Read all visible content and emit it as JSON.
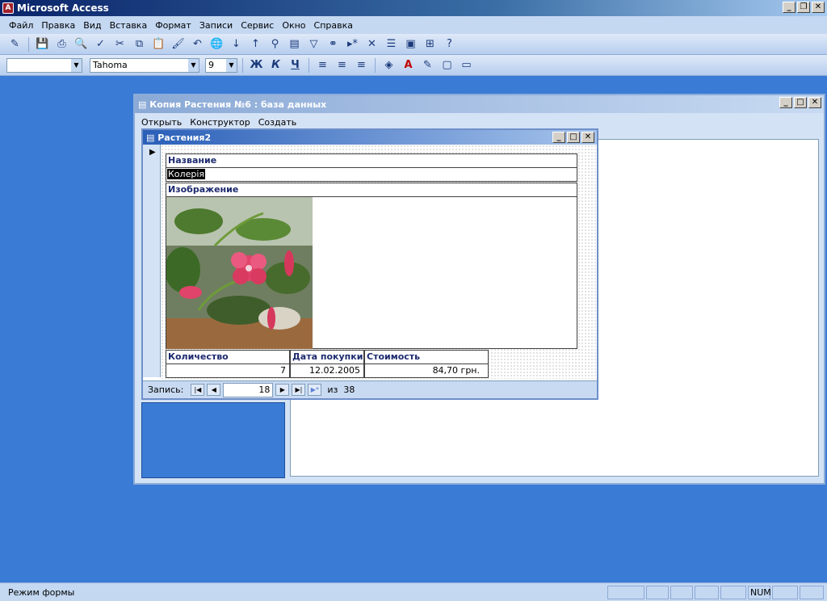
{
  "app": {
    "title": "Microsoft Access"
  },
  "menu": [
    "Файл",
    "Правка",
    "Вид",
    "Вставка",
    "Формат",
    "Записи",
    "Сервис",
    "Окно",
    "Справка"
  ],
  "format_toolbar": {
    "font": "Tahoma",
    "size": "9",
    "bold": "Ж",
    "italic": "К",
    "underline": "Ч"
  },
  "db_window": {
    "title": "Копия Растения №6 : база данных",
    "open": "Открыть",
    "design": "Конструктор",
    "create": "Создать"
  },
  "form": {
    "title": "Растения2",
    "name_label": "Название",
    "name_value": "Колерія",
    "image_label": "Изображение",
    "qty_label": "Количество",
    "qty_value": "7",
    "date_label": "Дата покупки",
    "date_value": "12.02.2005",
    "cost_label": "Стоимость",
    "cost_value": "84,70 грн."
  },
  "nav": {
    "label": "Запись:",
    "current": "18",
    "of": "из",
    "total": "38"
  },
  "status": {
    "mode": "Режим формы",
    "num": "NUM"
  }
}
